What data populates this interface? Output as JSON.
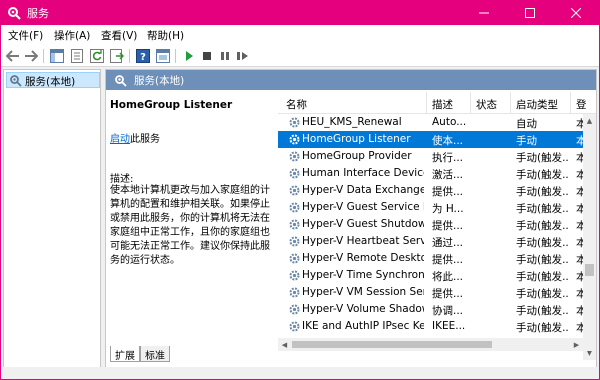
{
  "window": {
    "title": "服务",
    "accent_color": "#e5007e"
  },
  "menu": {
    "items": [
      "文件(F)",
      "操作(A)",
      "查看(V)",
      "帮助(H)"
    ]
  },
  "toolbar": {
    "icons": [
      "back-icon",
      "forward-icon",
      "console-tree-icon",
      "properties-icon",
      "refresh-icon",
      "export-icon",
      "help-icon",
      "console-icon",
      "start-icon",
      "stop-icon",
      "pause-icon",
      "restart-icon"
    ]
  },
  "tree": {
    "label": "服务(本地)"
  },
  "pane": {
    "header": "服务(本地)"
  },
  "description": {
    "service_name": "HomeGroup Listener",
    "start_link": "启动",
    "start_suffix": "此服务",
    "label": "描述:",
    "text": "使本地计算机更改与加入家庭组的计算机的配置和维护相关联。如果停止或禁用此服务，你的计算机将无法在家庭组中正常工作，且你的家庭组也可能无法正常工作。建议你保持此服务的运行状态。"
  },
  "table": {
    "columns": [
      "名称",
      "描述",
      "状态",
      "启动类型",
      "登"
    ],
    "rows": [
      {
        "name": "HEU_KMS_Renewal",
        "desc": "Auto...",
        "status": "",
        "startup": "自动",
        "logon": "本"
      },
      {
        "name": "HomeGroup Listener",
        "desc": "使本...",
        "status": "",
        "startup": "手动",
        "logon": "本",
        "selected": true
      },
      {
        "name": "HomeGroup Provider",
        "desc": "执行...",
        "status": "",
        "startup": "手动(触发...",
        "logon": "本"
      },
      {
        "name": "Human Interface Device ...",
        "desc": "激活...",
        "status": "",
        "startup": "手动(触发...",
        "logon": "本"
      },
      {
        "name": "Hyper-V Data Exchange ...",
        "desc": "提供...",
        "status": "",
        "startup": "手动(触发...",
        "logon": "本"
      },
      {
        "name": "Hyper-V Guest Service In...",
        "desc": "为 H...",
        "status": "",
        "startup": "手动(触发...",
        "logon": "本"
      },
      {
        "name": "Hyper-V Guest Shutdown...",
        "desc": "提供...",
        "status": "",
        "startup": "手动(触发...",
        "logon": "本"
      },
      {
        "name": "Hyper-V Heartbeat Service",
        "desc": "通过...",
        "status": "",
        "startup": "手动(触发...",
        "logon": "本"
      },
      {
        "name": "Hyper-V Remote Deskto...",
        "desc": "提供...",
        "status": "",
        "startup": "手动(触发...",
        "logon": "本"
      },
      {
        "name": "Hyper-V Time Synchroniz...",
        "desc": "将此...",
        "status": "",
        "startup": "手动(触发...",
        "logon": "本"
      },
      {
        "name": "Hyper-V VM Session Ser...",
        "desc": "提供...",
        "status": "",
        "startup": "手动(触发...",
        "logon": "本"
      },
      {
        "name": "Hyper-V Volume Shadow...",
        "desc": "协调...",
        "status": "",
        "startup": "手动(触发...",
        "logon": "本"
      },
      {
        "name": "IKE and AuthIP IPsec Key...",
        "desc": "IKEE...",
        "status": "",
        "startup": "手动(触发...",
        "logon": "本"
      }
    ]
  },
  "tabs": [
    "扩展",
    "标准"
  ]
}
